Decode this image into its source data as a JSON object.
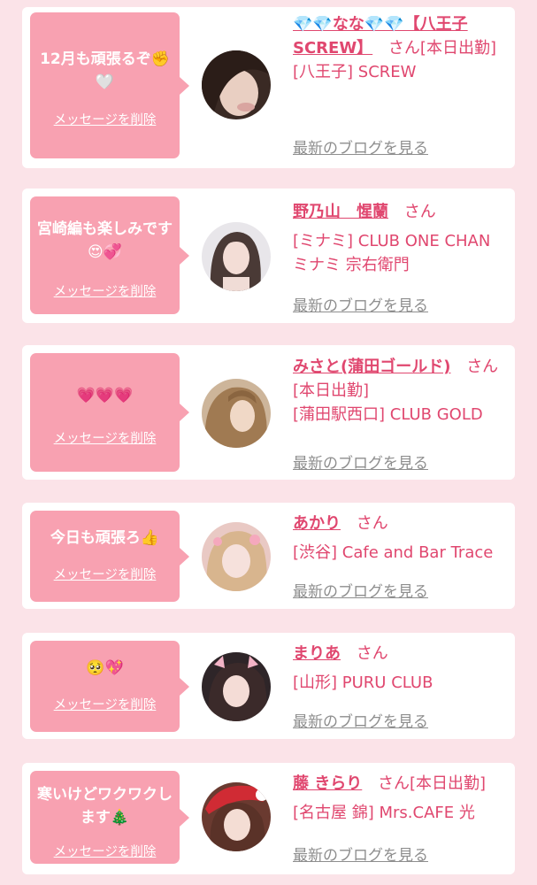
{
  "messages": [
    {
      "bubble_text": "12月も頑張るぞ✊🤍",
      "delete_label": "メッセージを削除",
      "name": "💎💎なな💎💎【八王子SCREW】",
      "san": "さん",
      "status": "[本日出勤]",
      "store": "[八王子] SCREW",
      "blog_label": "最新のブログを見る"
    },
    {
      "bubble_text": "宮崎編も楽しみです😍💞",
      "delete_label": "メッセージを削除",
      "name": "野乃山　惺蘭",
      "san": "さん",
      "status": "",
      "store": "[ミナミ] CLUB ONE CHAN ミナミ 宗右衛門",
      "blog_label": "最新のブログを見る"
    },
    {
      "bubble_text": "💗💗💗",
      "delete_label": "メッセージを削除",
      "name": "みさと(蒲田ゴールド)",
      "san": "さん",
      "status": "[本日出勤]",
      "store": "[蒲田駅西口] CLUB GOLD",
      "blog_label": "最新のブログを見る"
    },
    {
      "bubble_text": "今日も頑張ろ👍",
      "delete_label": "メッセージを削除",
      "name": "あかり",
      "san": "さん",
      "status": "",
      "store": "[渋谷] Cafe and Bar Trace",
      "blog_label": "最新のブログを見る"
    },
    {
      "bubble_text": "🥺💖",
      "delete_label": "メッセージを削除",
      "name": "まりあ",
      "san": "さん",
      "status": "",
      "store": "[山形] PURU CLUB",
      "blog_label": "最新のブログを見る"
    },
    {
      "bubble_text": "寒いけどワクワクします🎄",
      "delete_label": "メッセージを削除",
      "name": "藤 きらり",
      "san": "さん",
      "status": "[本日出勤]",
      "store": "[名古屋 錦] Mrs.CAFE 光",
      "blog_label": "最新のブログを見る"
    }
  ],
  "colors": {
    "page_background": "#fbe3e8",
    "bubble": "#f8a1b1",
    "name_pink": "#e0476f",
    "blog_gray": "#8e8e8e"
  }
}
